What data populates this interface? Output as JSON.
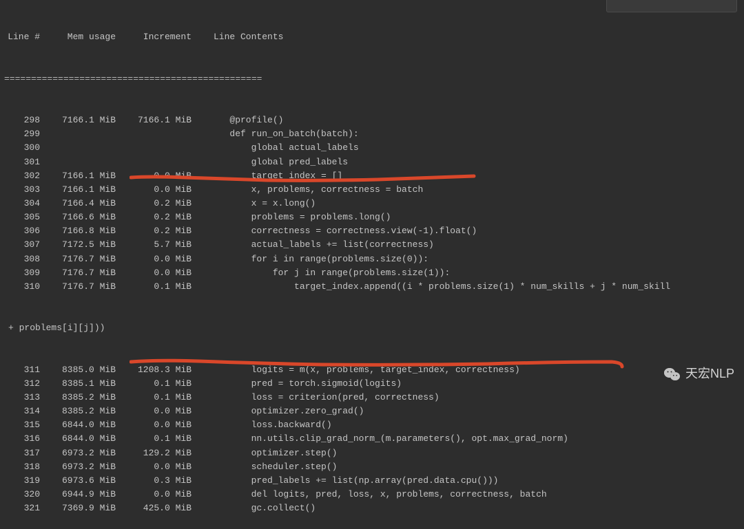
{
  "header": {
    "line": "Line #",
    "mem": "Mem usage",
    "incr": "Increment",
    "content": "Line Contents"
  },
  "divider": "================================================",
  "rows": [
    {
      "line": "298",
      "mem": "7166.1 MiB",
      "incr": "7166.1 MiB",
      "content": "   @profile()"
    },
    {
      "line": "299",
      "mem": "",
      "incr": "",
      "content": "   def run_on_batch(batch):"
    },
    {
      "line": "300",
      "mem": "",
      "incr": "",
      "content": "       global actual_labels"
    },
    {
      "line": "301",
      "mem": "",
      "incr": "",
      "content": "       global pred_labels"
    },
    {
      "line": "302",
      "mem": "7166.1 MiB",
      "incr": "0.0 MiB",
      "content": "       target_index = []"
    },
    {
      "line": "303",
      "mem": "7166.1 MiB",
      "incr": "0.0 MiB",
      "content": "       x, problems, correctness = batch"
    },
    {
      "line": "304",
      "mem": "7166.4 MiB",
      "incr": "0.2 MiB",
      "content": "       x = x.long()"
    },
    {
      "line": "305",
      "mem": "7166.6 MiB",
      "incr": "0.2 MiB",
      "content": "       problems = problems.long()"
    },
    {
      "line": "306",
      "mem": "7166.8 MiB",
      "incr": "0.2 MiB",
      "content": "       correctness = correctness.view(-1).float()"
    },
    {
      "line": "307",
      "mem": "7172.5 MiB",
      "incr": "5.7 MiB",
      "content": "       actual_labels += list(correctness)"
    },
    {
      "line": "308",
      "mem": "7176.7 MiB",
      "incr": "0.0 MiB",
      "content": "       for i in range(problems.size(0)):"
    },
    {
      "line": "309",
      "mem": "7176.7 MiB",
      "incr": "0.0 MiB",
      "content": "           for j in range(problems.size(1)):"
    },
    {
      "line": "310",
      "mem": "7176.7 MiB",
      "incr": "0.1 MiB",
      "content": "               target_index.append((i * problems.size(1) * num_skills + j * num_skill"
    }
  ],
  "continuation": "+ problems[i][j]))",
  "rows2": [
    {
      "line": "311",
      "mem": "8385.0 MiB",
      "incr": "1208.3 MiB",
      "content": "       logits = m(x, problems, target_index, correctness)"
    },
    {
      "line": "312",
      "mem": "8385.1 MiB",
      "incr": "0.1 MiB",
      "content": "       pred = torch.sigmoid(logits)"
    },
    {
      "line": "313",
      "mem": "8385.2 MiB",
      "incr": "0.1 MiB",
      "content": "       loss = criterion(pred, correctness)"
    },
    {
      "line": "314",
      "mem": "8385.2 MiB",
      "incr": "0.0 MiB",
      "content": "       optimizer.zero_grad()"
    },
    {
      "line": "315",
      "mem": "6844.0 MiB",
      "incr": "0.0 MiB",
      "content": "       loss.backward()"
    },
    {
      "line": "316",
      "mem": "6844.0 MiB",
      "incr": "0.1 MiB",
      "content": "       nn.utils.clip_grad_norm_(m.parameters(), opt.max_grad_norm)"
    },
    {
      "line": "317",
      "mem": "6973.2 MiB",
      "incr": "129.2 MiB",
      "content": "       optimizer.step()"
    },
    {
      "line": "318",
      "mem": "6973.2 MiB",
      "incr": "0.0 MiB",
      "content": "       scheduler.step()"
    },
    {
      "line": "319",
      "mem": "6973.6 MiB",
      "incr": "0.3 MiB",
      "content": "       pred_labels += list(np.array(pred.data.cpu()))"
    },
    {
      "line": "320",
      "mem": "6944.9 MiB",
      "incr": "0.0 MiB",
      "content": "       del logits, pred, loss, x, problems, correctness, batch"
    },
    {
      "line": "321",
      "mem": "7369.9 MiB",
      "incr": "425.0 MiB",
      "content": "       gc.collect()"
    }
  ],
  "watermark": {
    "text": "天宏NLP"
  }
}
